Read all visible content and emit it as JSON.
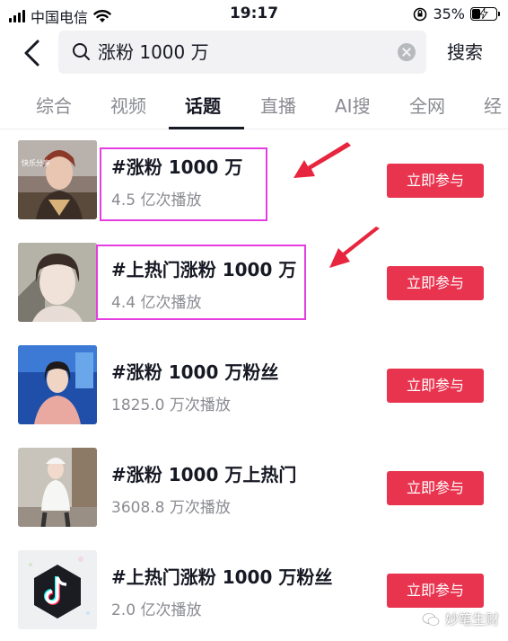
{
  "status_bar": {
    "carrier": "中国电信",
    "time": "19:17",
    "battery": "35%",
    "battery_level": 0.35
  },
  "search": {
    "query": "涨粉 1000 万",
    "submit_label": "搜索"
  },
  "tabs": [
    {
      "label": "综合"
    },
    {
      "label": "视频"
    },
    {
      "label": "话题",
      "active": true
    },
    {
      "label": "直播"
    },
    {
      "label": "AI搜"
    },
    {
      "label": "全网"
    },
    {
      "label": "经"
    }
  ],
  "topics": [
    {
      "title": "#涨粉 1000 万",
      "views": "4.5 亿次播放",
      "button": "立即参与",
      "thumb_caption": "快乐分享"
    },
    {
      "title": "#上热门涨粉 1000 万",
      "views": "4.4 亿次播放",
      "button": "立即参与"
    },
    {
      "title": "#涨粉 1000 万粉丝",
      "views": "1825.0 万次播放",
      "button": "立即参与"
    },
    {
      "title": "#涨粉 1000 万上热门",
      "views": "3608.8 万次播放",
      "button": "立即参与"
    },
    {
      "title": "#上热门涨粉 1000 万粉丝",
      "views": "2.0 亿次播放",
      "button": "立即参与"
    }
  ],
  "watermark": "妙笔生财",
  "colors": {
    "join_button": "#e8344f",
    "highlight": "#e43de0",
    "arrow": "#e8253f",
    "inactive_tab": "#8a8b91"
  }
}
